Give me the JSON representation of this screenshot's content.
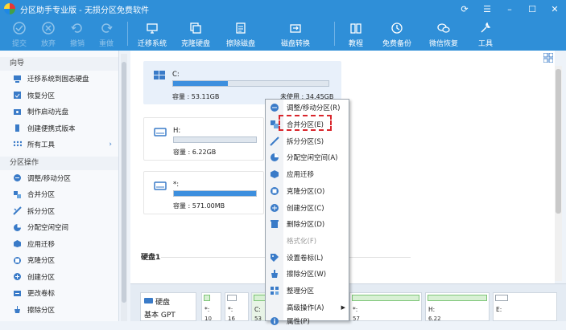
{
  "window": {
    "title": "分区助手专业版 - 无损分区免费软件"
  },
  "toolbar": {
    "items": [
      {
        "key": "submit",
        "label": "提交",
        "disabled": true
      },
      {
        "key": "discard",
        "label": "放弃",
        "disabled": true
      },
      {
        "key": "undo",
        "label": "撤销",
        "disabled": true
      },
      {
        "key": "redo",
        "label": "重做",
        "disabled": true
      },
      {
        "key": "migrate",
        "label": "迁移系统",
        "disabled": false
      },
      {
        "key": "clone",
        "label": "克隆硬盘",
        "disabled": false
      },
      {
        "key": "wipe",
        "label": "擦除磁盘",
        "disabled": false
      },
      {
        "key": "convert",
        "label": "磁盘转换",
        "disabled": false
      },
      {
        "key": "tutorial",
        "label": "教程",
        "disabled": false
      },
      {
        "key": "backup",
        "label": "免费备份",
        "disabled": false
      },
      {
        "key": "recovery",
        "label": "微信恢复",
        "disabled": false
      },
      {
        "key": "tools",
        "label": "工具",
        "disabled": false
      }
    ]
  },
  "sidebar": {
    "wizard_title": "向导",
    "wizard_items": [
      "迁移系统到固态硬盘",
      "恢复分区",
      "制作启动光盘",
      "创建便携式版本",
      "所有工具"
    ],
    "ops_title": "分区操作",
    "ops_items": [
      "调整/移动分区",
      "合并分区",
      "拆分分区",
      "分配空闲空间",
      "应用迁移",
      "克隆分区",
      "创建分区",
      "更改卷标",
      "擦除分区"
    ]
  },
  "volumes": [
    {
      "name": "C:",
      "capacity": "容量 : 53.11GB",
      "free": "未使用 : 34.45GB",
      "fill": 0.35
    },
    {
      "name": "H:",
      "capacity": "容量 : 6.22GB",
      "free": "",
      "fill": 0.0
    },
    {
      "name": "*:",
      "capacity": "容量 : 571.00MB",
      "free": "",
      "fill": 1.0
    }
  ],
  "disk": {
    "label": "硬盘1",
    "card_title": "硬盘",
    "card_type": "基本 GPT",
    "partitions": [
      {
        "label": "*:",
        "sub": "10"
      },
      {
        "label": "*:",
        "sub": "16"
      },
      {
        "label": "C:",
        "sub": "53"
      },
      {
        "label": "*:",
        "sub": "57"
      },
      {
        "label": "H:",
        "sub": "6.22"
      },
      {
        "label": "E:",
        "sub": ""
      }
    ]
  },
  "context_menu": {
    "items": [
      {
        "label": "调整/移动分区(R)",
        "disabled": false,
        "submenu": false,
        "icon": "resize-icon"
      },
      {
        "label": "合并分区(E)",
        "disabled": false,
        "submenu": false,
        "icon": "merge-icon"
      },
      {
        "label": "拆分分区(S)",
        "disabled": false,
        "submenu": false,
        "icon": "split-icon"
      },
      {
        "label": "分配空闲空间(A)",
        "disabled": false,
        "submenu": false,
        "icon": "allocate-icon"
      },
      {
        "label": "应用迁移",
        "disabled": false,
        "submenu": false,
        "icon": "migrate-icon"
      },
      {
        "label": "克隆分区(O)",
        "disabled": false,
        "submenu": false,
        "icon": "clone-icon"
      },
      {
        "label": "创建分区(C)",
        "disabled": false,
        "submenu": false,
        "icon": "create-icon"
      },
      {
        "label": "删除分区(D)",
        "disabled": false,
        "submenu": false,
        "icon": "delete-icon"
      },
      {
        "label": "格式化(F)",
        "disabled": true,
        "submenu": false,
        "icon": ""
      },
      {
        "label": "设置卷标(L)",
        "disabled": false,
        "submenu": false,
        "icon": "label-icon"
      },
      {
        "label": "擦除分区(W)",
        "disabled": false,
        "submenu": false,
        "icon": "wipe-icon"
      },
      {
        "label": "整理分区",
        "disabled": false,
        "submenu": false,
        "icon": "defrag-icon"
      },
      {
        "label": "高级操作(A)",
        "disabled": false,
        "submenu": true,
        "icon": ""
      },
      {
        "label": "属性(P)",
        "disabled": false,
        "submenu": false,
        "icon": "properties-icon"
      }
    ]
  },
  "colors": {
    "accent": "#2f8fd8",
    "highlight": "#d9262c"
  }
}
